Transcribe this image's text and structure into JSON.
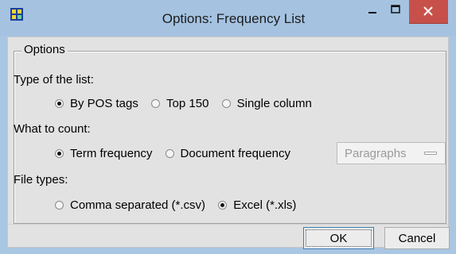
{
  "window": {
    "title": "Options: Frequency List",
    "close_color": "#c7514a",
    "titlebar_color": "#a5c3e1",
    "icons": [
      "app-icon",
      "minimize-icon",
      "maximize-icon",
      "close-icon"
    ]
  },
  "options_group": {
    "legend": "Options",
    "type_of_list": {
      "label": "Type of the list:",
      "options": [
        {
          "label": "By POS tags",
          "selected": true
        },
        {
          "label": "Top 150",
          "selected": false
        },
        {
          "label": "Single column",
          "selected": false
        }
      ]
    },
    "what_to_count": {
      "label": "What to count:",
      "options": [
        {
          "label": "Term frequency",
          "selected": true
        },
        {
          "label": "Document frequency",
          "selected": false
        }
      ],
      "unit_select": {
        "value": "Paragraphs",
        "enabled": false
      }
    },
    "file_types": {
      "label": "File types:",
      "options": [
        {
          "label": "Comma separated (*.csv)",
          "selected": false
        },
        {
          "label": "Excel (*.xls)",
          "selected": true
        }
      ]
    }
  },
  "buttons": {
    "ok": "OK",
    "cancel": "Cancel"
  }
}
